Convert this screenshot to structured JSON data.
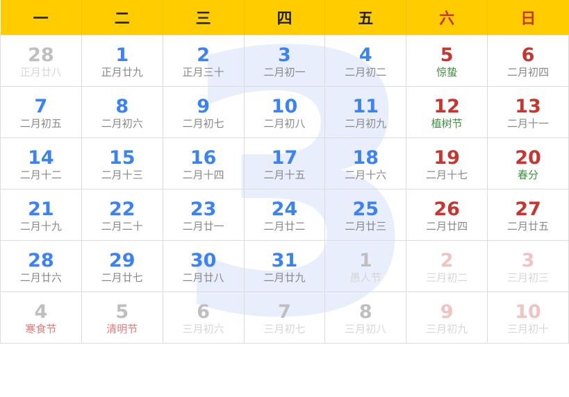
{
  "watermark": "3",
  "weekdays": [
    {
      "label": "一",
      "weekend": false
    },
    {
      "label": "二",
      "weekend": false
    },
    {
      "label": "三",
      "weekend": false
    },
    {
      "label": "四",
      "weekend": false
    },
    {
      "label": "五",
      "weekend": false
    },
    {
      "label": "六",
      "weekend": true
    },
    {
      "label": "日",
      "weekend": true
    }
  ],
  "colors": {
    "header_bg": "#ffcc00",
    "weekday_num": "#3b82f6",
    "weekend_num": "#c8352f",
    "lunar_text": "#888888",
    "solar_term": "#3f8f3f",
    "holiday_other": "#e7797a",
    "other_month_num": "#bfbfbf",
    "other_month_weekend_num": "#f1c4c4",
    "other_month_lunar": "#d6d6d6"
  },
  "weeks": [
    [
      {
        "day": "28",
        "lunar": "正月廿八",
        "current": false,
        "weekend": false,
        "festival": false
      },
      {
        "day": "1",
        "lunar": "正月廿九",
        "current": true,
        "weekend": false,
        "festival": false
      },
      {
        "day": "2",
        "lunar": "正月三十",
        "current": true,
        "weekend": false,
        "festival": false
      },
      {
        "day": "3",
        "lunar": "二月初一",
        "current": true,
        "weekend": false,
        "festival": false
      },
      {
        "day": "4",
        "lunar": "二月初二",
        "current": true,
        "weekend": false,
        "festival": false
      },
      {
        "day": "5",
        "lunar": "惊蛰",
        "current": true,
        "weekend": true,
        "festival": true
      },
      {
        "day": "6",
        "lunar": "二月初四",
        "current": true,
        "weekend": true,
        "festival": false
      }
    ],
    [
      {
        "day": "7",
        "lunar": "二月初五",
        "current": true,
        "weekend": false,
        "festival": false
      },
      {
        "day": "8",
        "lunar": "二月初六",
        "current": true,
        "weekend": false,
        "festival": false
      },
      {
        "day": "9",
        "lunar": "二月初七",
        "current": true,
        "weekend": false,
        "festival": false
      },
      {
        "day": "10",
        "lunar": "二月初八",
        "current": true,
        "weekend": false,
        "festival": false
      },
      {
        "day": "11",
        "lunar": "二月初九",
        "current": true,
        "weekend": false,
        "festival": false
      },
      {
        "day": "12",
        "lunar": "植树节",
        "current": true,
        "weekend": true,
        "festival": true
      },
      {
        "day": "13",
        "lunar": "二月十一",
        "current": true,
        "weekend": true,
        "festival": false
      }
    ],
    [
      {
        "day": "14",
        "lunar": "二月十二",
        "current": true,
        "weekend": false,
        "festival": false
      },
      {
        "day": "15",
        "lunar": "二月十三",
        "current": true,
        "weekend": false,
        "festival": false
      },
      {
        "day": "16",
        "lunar": "二月十四",
        "current": true,
        "weekend": false,
        "festival": false
      },
      {
        "day": "17",
        "lunar": "二月十五",
        "current": true,
        "weekend": false,
        "festival": false
      },
      {
        "day": "18",
        "lunar": "二月十六",
        "current": true,
        "weekend": false,
        "festival": false
      },
      {
        "day": "19",
        "lunar": "二月十七",
        "current": true,
        "weekend": true,
        "festival": false
      },
      {
        "day": "20",
        "lunar": "春分",
        "current": true,
        "weekend": true,
        "festival": true
      }
    ],
    [
      {
        "day": "21",
        "lunar": "二月十九",
        "current": true,
        "weekend": false,
        "festival": false
      },
      {
        "day": "22",
        "lunar": "二月二十",
        "current": true,
        "weekend": false,
        "festival": false
      },
      {
        "day": "23",
        "lunar": "二月廿一",
        "current": true,
        "weekend": false,
        "festival": false
      },
      {
        "day": "24",
        "lunar": "二月廿二",
        "current": true,
        "weekend": false,
        "festival": false
      },
      {
        "day": "25",
        "lunar": "二月廿三",
        "current": true,
        "weekend": false,
        "festival": false
      },
      {
        "day": "26",
        "lunar": "二月廿四",
        "current": true,
        "weekend": true,
        "festival": false
      },
      {
        "day": "27",
        "lunar": "二月廿五",
        "current": true,
        "weekend": true,
        "festival": false
      }
    ],
    [
      {
        "day": "28",
        "lunar": "二月廿六",
        "current": true,
        "weekend": false,
        "festival": false
      },
      {
        "day": "29",
        "lunar": "二月廿七",
        "current": true,
        "weekend": false,
        "festival": false
      },
      {
        "day": "30",
        "lunar": "二月廿八",
        "current": true,
        "weekend": false,
        "festival": false
      },
      {
        "day": "31",
        "lunar": "二月廿九",
        "current": true,
        "weekend": false,
        "festival": false
      },
      {
        "day": "1",
        "lunar": "愚人节",
        "current": false,
        "weekend": false,
        "festival": true
      },
      {
        "day": "2",
        "lunar": "三月初二",
        "current": false,
        "weekend": true,
        "festival": false
      },
      {
        "day": "3",
        "lunar": "三月初三",
        "current": false,
        "weekend": true,
        "festival": false
      }
    ],
    [
      {
        "day": "4",
        "lunar": "寒食节",
        "current": false,
        "weekend": false,
        "festival": true,
        "holiday": true
      },
      {
        "day": "5",
        "lunar": "清明节",
        "current": false,
        "weekend": false,
        "festival": true,
        "holiday": true
      },
      {
        "day": "6",
        "lunar": "三月初六",
        "current": false,
        "weekend": false,
        "festival": false
      },
      {
        "day": "7",
        "lunar": "三月初七",
        "current": false,
        "weekend": false,
        "festival": false
      },
      {
        "day": "8",
        "lunar": "三月初八",
        "current": false,
        "weekend": false,
        "festival": false
      },
      {
        "day": "9",
        "lunar": "三月初九",
        "current": false,
        "weekend": true,
        "festival": false
      },
      {
        "day": "10",
        "lunar": "三月初十",
        "current": false,
        "weekend": true,
        "festival": false
      }
    ]
  ]
}
